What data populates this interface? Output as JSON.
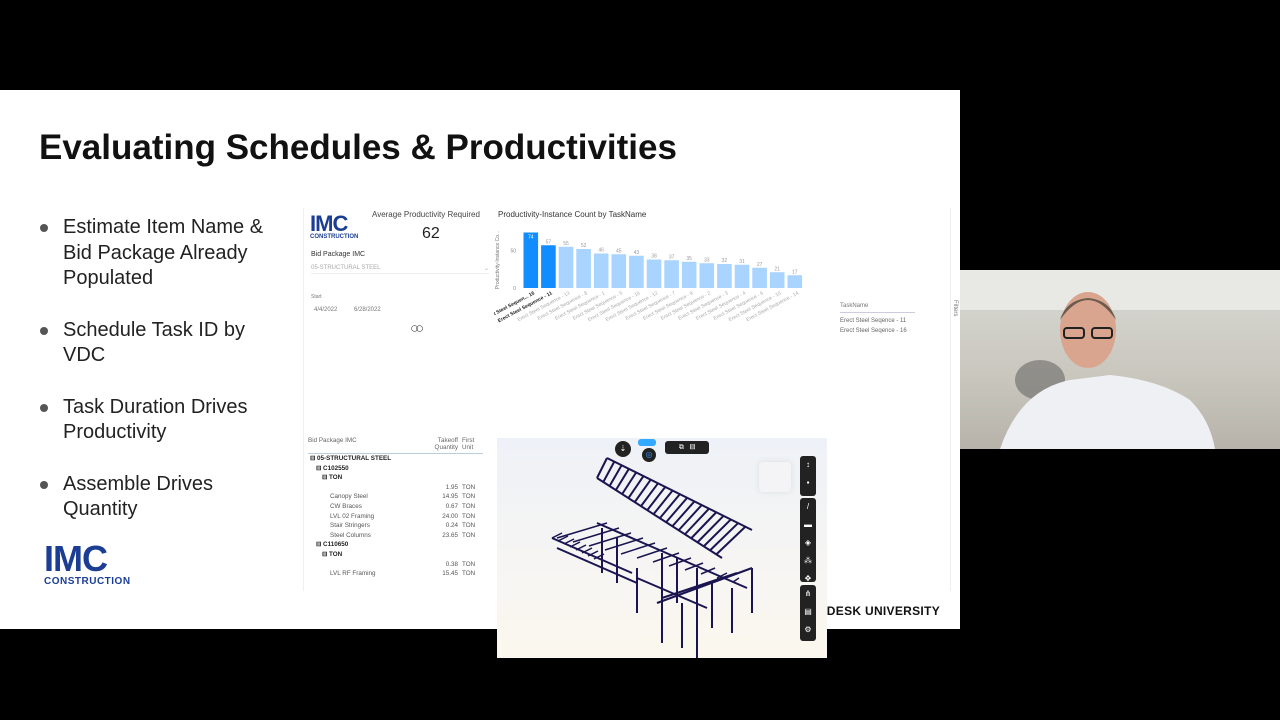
{
  "slide": {
    "title": "Evaluating Schedules & Productivities",
    "bullets": [
      "Estimate Item Name & Bid Package Already Populated",
      "Schedule Task ID by VDC",
      "Task Duration Drives Productivity",
      "Assemble Drives Quantity"
    ],
    "logo": {
      "main": "IMC",
      "sub": "CONSTRUCTION"
    },
    "footer": "AUTODESK UNIVERSITY"
  },
  "dashboard": {
    "kpi": {
      "label": "Average Productivity Required",
      "value": "62"
    },
    "bid_package": {
      "label": "Bid Package IMC",
      "selected": "05-STRUCTURAL STEEL"
    },
    "date": {
      "label": "Start",
      "from": "4/4/2022",
      "to": "6/28/2022"
    },
    "matrix": {
      "headers": [
        "Bid Package IMC",
        "Takeoff Quantity",
        "First Unit"
      ],
      "rows": [
        [
          "⊟ 05-STRUCTURAL STEEL",
          "",
          ""
        ],
        [
          "⊟ C102550",
          "",
          ""
        ],
        [
          "⊟ TON",
          "",
          ""
        ],
        [
          "",
          "1.95",
          "TON"
        ],
        [
          "Canopy Steel",
          "14.95",
          "TON"
        ],
        [
          "CW Braces",
          "0.67",
          "TON"
        ],
        [
          "LVL 02 Framing",
          "24.00",
          "TON"
        ],
        [
          "Stair Stringers",
          "0.24",
          "TON"
        ],
        [
          "Steel Columns",
          "23.65",
          "TON"
        ],
        [
          "⊟ C110650",
          "",
          ""
        ],
        [
          "⊟ TON",
          "",
          ""
        ],
        [
          "",
          "0.38",
          "TON"
        ],
        [
          "LVL RF Framing",
          "15.45",
          "TON"
        ]
      ]
    },
    "slicer": {
      "header": "TaskName",
      "items": [
        "Erect Steel Seqence - 11",
        "Erect Steel Seqence - 16"
      ]
    },
    "filters_label": "Filters",
    "colors": {
      "selected": "#118dff",
      "unselected": "#a8d4ff"
    }
  },
  "chart_data": {
    "type": "bar",
    "title": "Productivity-Instance Count by TaskName",
    "xlabel": "",
    "ylabel": "Productivity-Instance Co...",
    "yticks": [
      "0",
      "50"
    ],
    "ylim": [
      0,
      80
    ],
    "categories": [
      "Erect Steel Sequen... 16",
      "Erect Steel Sequence - 11",
      "Erect Steel Sequence - 13",
      "Erect Steel Sequence - 8",
      "Erect Steel Sequence - 1",
      "Erect Steel Sequence - 5",
      "Erect Steel Sequence - 15",
      "Erect Steel Sequence - 12",
      "Erect Steel Sequence - 7",
      "Erect Steel Sequence - 9",
      "Erect Steel Sequence - 2",
      "Erect Steel Sequence - 3",
      "Erect Steel Sequence - 4",
      "Erect Steel Sequence - 6",
      "Erect Steel Sequence - 10",
      "Erect Steel Sequence - 14"
    ],
    "values": [
      74,
      57,
      55,
      52,
      46,
      45,
      43,
      38,
      37,
      35,
      33,
      32,
      31,
      27,
      21,
      17
    ],
    "selected": [
      true,
      true,
      false,
      false,
      false,
      false,
      false,
      false,
      false,
      false,
      false,
      false,
      false,
      false,
      false,
      false
    ]
  }
}
